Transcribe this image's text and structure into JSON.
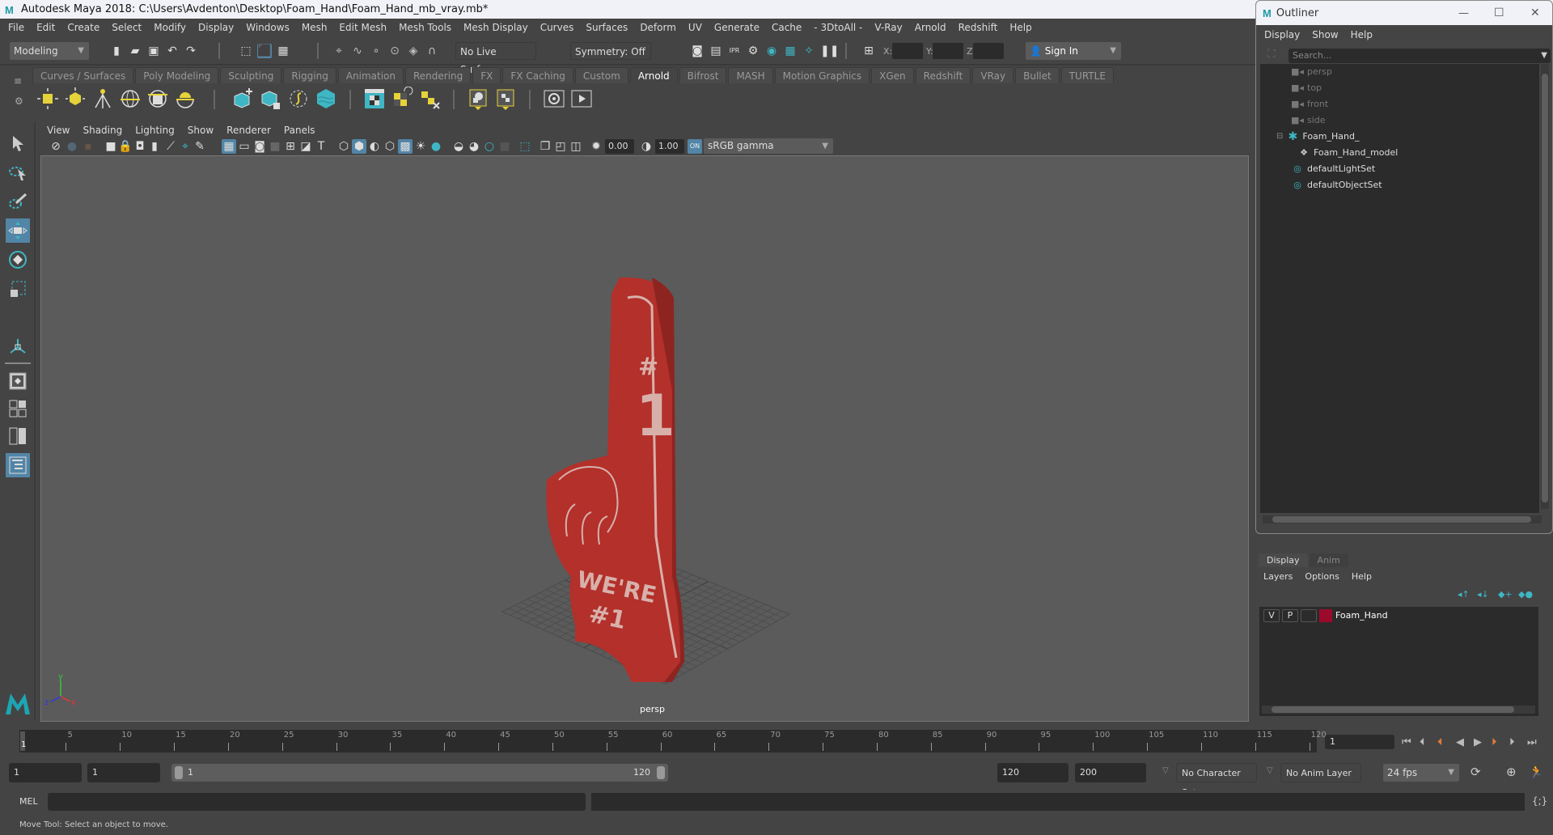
{
  "window": {
    "title": "Autodesk Maya 2018: C:\\Users\\Avdenton\\Desktop\\Foam_Hand\\Foam_Hand_mb_vray.mb*"
  },
  "menubar": [
    "File",
    "Edit",
    "Create",
    "Select",
    "Modify",
    "Display",
    "Windows",
    "Mesh",
    "Edit Mesh",
    "Mesh Tools",
    "Mesh Display",
    "Curves",
    "Surfaces",
    "Deform",
    "UV",
    "Generate",
    "Cache",
    "- 3DtoAll -",
    "V-Ray",
    "Arnold",
    "Redshift",
    "Help"
  ],
  "statusline": {
    "menuset": "Modeling",
    "live_surface": "No Live Surface",
    "symmetry": "Symmetry: Off",
    "x_label": "X:",
    "y_label": "Y:",
    "z_label": "Z:",
    "sign_in": "Sign In"
  },
  "shelf": {
    "tabs": [
      "Curves / Surfaces",
      "Poly Modeling",
      "Sculpting",
      "Rigging",
      "Animation",
      "Rendering",
      "FX",
      "FX Caching",
      "Custom",
      "Arnold",
      "Bifrost",
      "MASH",
      "Motion Graphics",
      "XGen",
      "Redshift",
      "VRay",
      "Bullet",
      "TURTLE"
    ],
    "active_tab": "Arnold"
  },
  "panel": {
    "menu": [
      "View",
      "Shading",
      "Lighting",
      "Show",
      "Renderer",
      "Panels"
    ],
    "exposure": "0.00",
    "gamma": "1.00",
    "color_space": "sRGB gamma",
    "camera_label": "persp"
  },
  "outliner": {
    "title": "Outliner",
    "menu": [
      "Display",
      "Show",
      "Help"
    ],
    "search_placeholder": "Search...",
    "items": [
      {
        "label": "persp",
        "icon": "camera-icon",
        "dim": true
      },
      {
        "label": "top",
        "icon": "camera-icon",
        "dim": true
      },
      {
        "label": "front",
        "icon": "camera-icon",
        "dim": true
      },
      {
        "label": "side",
        "icon": "camera-icon",
        "dim": true
      },
      {
        "label": "Foam_Hand_",
        "icon": "group-icon",
        "dim": false
      },
      {
        "label": "Foam_Hand_model",
        "icon": "mesh-icon",
        "dim": false
      },
      {
        "label": "defaultLightSet",
        "icon": "set-icon",
        "dim": false
      },
      {
        "label": "defaultObjectSet",
        "icon": "set-icon",
        "dim": false
      }
    ]
  },
  "layer_editor": {
    "tabs": [
      "Display",
      "Anim"
    ],
    "menu": [
      "Layers",
      "Options",
      "Help"
    ],
    "layers": [
      {
        "v": "V",
        "p": "P",
        "name": "Foam_Hand",
        "color": "#9b0a2a"
      }
    ]
  },
  "timeline": {
    "ticks": [
      "5",
      "10",
      "15",
      "20",
      "25",
      "30",
      "35",
      "40",
      "45",
      "50",
      "55",
      "60",
      "65",
      "70",
      "75",
      "80",
      "85",
      "90",
      "95",
      "100",
      "105",
      "110",
      "115",
      "120"
    ],
    "current_frame_marker": "1",
    "current_frame": "1"
  },
  "range": {
    "start": "1",
    "playback_start": "1",
    "slider_start": "1",
    "slider_end": "120",
    "playback_end": "120",
    "end": "200",
    "character_set": "No Character Set",
    "anim_layer": "No Anim Layer",
    "fps": "24 fps"
  },
  "command_line": {
    "language": "MEL"
  },
  "help_line": "Move Tool: Select an object to move."
}
